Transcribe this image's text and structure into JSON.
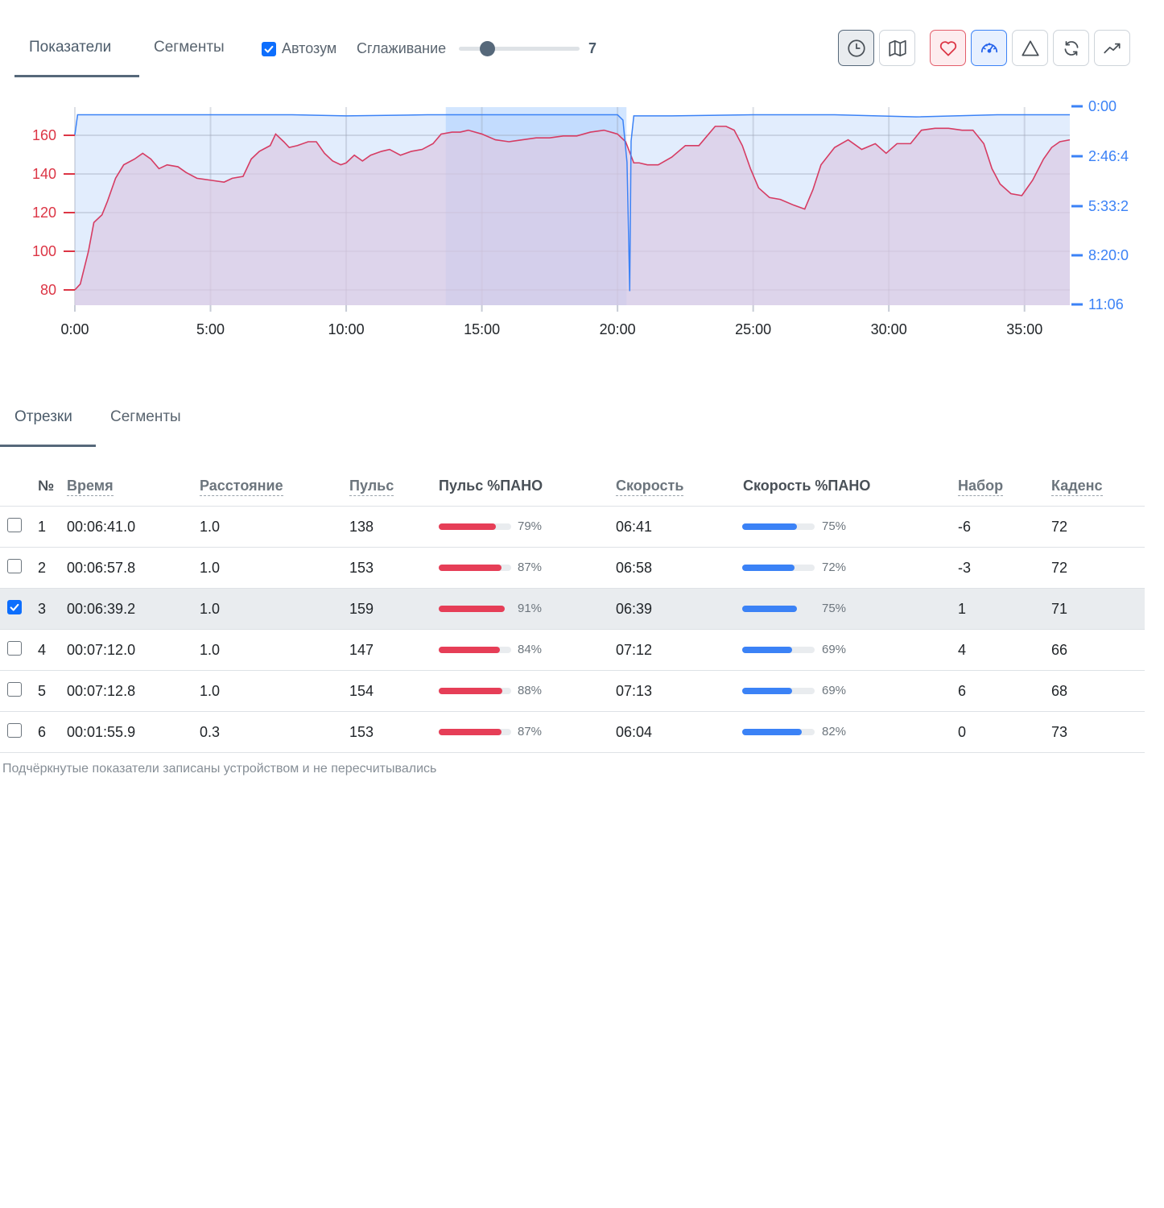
{
  "toolbar": {
    "tabs": [
      "Показатели",
      "Сегменты"
    ],
    "autozoom_label": "Автозум",
    "autozoom_checked": true,
    "smoothing_label": "Сглаживание",
    "smoothing_value": "7",
    "buttons": [
      "clock-icon",
      "map-icon",
      "heart-icon",
      "speedometer-icon",
      "triangle-icon",
      "refresh-icon",
      "trend-icon"
    ]
  },
  "chart_data": {
    "type": "area",
    "x_ticks": [
      "0:00",
      "5:00",
      "10:00",
      "15:00",
      "20:00",
      "25:00",
      "30:00",
      "35:00"
    ],
    "y_left_ticks": [
      "80",
      "100",
      "120",
      "140",
      "160"
    ],
    "y_right_ticks": [
      "0:00",
      "2:46:4",
      "5:33:2",
      "8:20:0",
      "11:06"
    ],
    "x_unit": "minutes",
    "xlim": [
      0,
      36.67
    ],
    "ylim_left": [
      72,
      175
    ],
    "colors": {
      "heart_rate": "#d63c63",
      "pace": "#3b82f6"
    },
    "selection_min": [
      13.67,
      20.33
    ],
    "series": [
      {
        "metric": "heart_rate",
        "points": [
          [
            0,
            80
          ],
          [
            0.2,
            83
          ],
          [
            0.5,
            100
          ],
          [
            0.7,
            115
          ],
          [
            1,
            119
          ],
          [
            1.2,
            126
          ],
          [
            1.5,
            138
          ],
          [
            1.8,
            145
          ],
          [
            2.2,
            148
          ],
          [
            2.5,
            151
          ],
          [
            2.8,
            148
          ],
          [
            3.1,
            143
          ],
          [
            3.4,
            145
          ],
          [
            3.8,
            144
          ],
          [
            4.1,
            141
          ],
          [
            4.5,
            138
          ],
          [
            5,
            137
          ],
          [
            5.5,
            136
          ],
          [
            5.8,
            138
          ],
          [
            6.2,
            139
          ],
          [
            6.5,
            148
          ],
          [
            6.8,
            152
          ],
          [
            7.2,
            155
          ],
          [
            7.4,
            161
          ],
          [
            7.7,
            157
          ],
          [
            7.9,
            154
          ],
          [
            8.2,
            155
          ],
          [
            8.6,
            157
          ],
          [
            8.9,
            157
          ],
          [
            9.2,
            151
          ],
          [
            9.5,
            147
          ],
          [
            9.8,
            145
          ],
          [
            10,
            146
          ],
          [
            10.3,
            150
          ],
          [
            10.6,
            147
          ],
          [
            10.9,
            150
          ],
          [
            11.3,
            152
          ],
          [
            11.6,
            153
          ],
          [
            12,
            150
          ],
          [
            12.4,
            152
          ],
          [
            12.8,
            153
          ],
          [
            13.2,
            156
          ],
          [
            13.5,
            161
          ],
          [
            13.9,
            162
          ],
          [
            14.2,
            162
          ],
          [
            14.5,
            163
          ],
          [
            15,
            161
          ],
          [
            15.5,
            158
          ],
          [
            16,
            157
          ],
          [
            16.5,
            158
          ],
          [
            17,
            159
          ],
          [
            17.5,
            159
          ],
          [
            18,
            160
          ],
          [
            18.5,
            160
          ],
          [
            19,
            162
          ],
          [
            19.5,
            163
          ],
          [
            20,
            161
          ],
          [
            20.3,
            157
          ],
          [
            20.6,
            146
          ],
          [
            20.8,
            146
          ],
          [
            21.1,
            145
          ],
          [
            21.5,
            145
          ],
          [
            22,
            149
          ],
          [
            22.5,
            155
          ],
          [
            23,
            155
          ],
          [
            23.3,
            160
          ],
          [
            23.6,
            165
          ],
          [
            24,
            165
          ],
          [
            24.3,
            163
          ],
          [
            24.6,
            155
          ],
          [
            24.9,
            143
          ],
          [
            25.2,
            133
          ],
          [
            25.6,
            128
          ],
          [
            26,
            127
          ],
          [
            26.5,
            124
          ],
          [
            26.9,
            122
          ],
          [
            27.2,
            132
          ],
          [
            27.5,
            145
          ],
          [
            28,
            154
          ],
          [
            28.5,
            158
          ],
          [
            29,
            153
          ],
          [
            29.5,
            156
          ],
          [
            29.9,
            151
          ],
          [
            30.3,
            156
          ],
          [
            30.8,
            156
          ],
          [
            31.2,
            163
          ],
          [
            31.7,
            164
          ],
          [
            32.2,
            164
          ],
          [
            32.7,
            163
          ],
          [
            33.1,
            163
          ],
          [
            33.5,
            156
          ],
          [
            33.8,
            143
          ],
          [
            34.1,
            135
          ],
          [
            34.5,
            130
          ],
          [
            34.9,
            129
          ],
          [
            35.3,
            137
          ],
          [
            35.7,
            148
          ],
          [
            36,
            154
          ],
          [
            36.3,
            157
          ],
          [
            36.67,
            158
          ]
        ]
      },
      {
        "metric": "pace",
        "points": [
          [
            0,
            1.2
          ],
          [
            0.1,
            0.25
          ],
          [
            2,
            0.25
          ],
          [
            5,
            0.25
          ],
          [
            8,
            0.25
          ],
          [
            10,
            0.3
          ],
          [
            13,
            0.25
          ],
          [
            16,
            0.25
          ],
          [
            20,
            0.25
          ],
          [
            20.2,
            0.5
          ],
          [
            20.35,
            2.5
          ],
          [
            20.45,
            8.6
          ],
          [
            20.5,
            1.5
          ],
          [
            20.6,
            0.3
          ],
          [
            22,
            0.3
          ],
          [
            25,
            0.25
          ],
          [
            28,
            0.25
          ],
          [
            31,
            0.35
          ],
          [
            34,
            0.25
          ],
          [
            36.67,
            0.25
          ]
        ]
      }
    ]
  },
  "segments_tabs": [
    "Отрезки",
    "Сегменты"
  ],
  "table": {
    "headers": {
      "num": "№",
      "time": "Время",
      "distance": "Расстояние",
      "hr": "Пульс",
      "hr_pano": "Пульс %ПАНО",
      "speed": "Скорость",
      "speed_pano": "Скорость %ПАНО",
      "elev": "Набор",
      "cadence": "Каденс"
    },
    "rows": [
      {
        "selected": false,
        "num": "1",
        "time": "00:06:41.0",
        "distance": "1.0",
        "hr": "138",
        "hr_pct": "79%",
        "hr_fill": 0.79,
        "speed": "06:41",
        "speed_pct": "75%",
        "speed_fill": 0.75,
        "elev": "-6",
        "cadence": "72"
      },
      {
        "selected": false,
        "num": "2",
        "time": "00:06:57.8",
        "distance": "1.0",
        "hr": "153",
        "hr_pct": "87%",
        "hr_fill": 0.87,
        "speed": "06:58",
        "speed_pct": "72%",
        "speed_fill": 0.72,
        "elev": "-3",
        "cadence": "72"
      },
      {
        "selected": true,
        "num": "3",
        "time": "00:06:39.2",
        "distance": "1.0",
        "hr": "159",
        "hr_pct": "91%",
        "hr_fill": 0.91,
        "speed": "06:39",
        "speed_pct": "75%",
        "speed_fill": 0.75,
        "elev": "1",
        "cadence": "71"
      },
      {
        "selected": false,
        "num": "4",
        "time": "00:07:12.0",
        "distance": "1.0",
        "hr": "147",
        "hr_pct": "84%",
        "hr_fill": 0.84,
        "speed": "07:12",
        "speed_pct": "69%",
        "speed_fill": 0.69,
        "elev": "4",
        "cadence": "66"
      },
      {
        "selected": false,
        "num": "5",
        "time": "00:07:12.8",
        "distance": "1.0",
        "hr": "154",
        "hr_pct": "88%",
        "hr_fill": 0.88,
        "speed": "07:13",
        "speed_pct": "69%",
        "speed_fill": 0.69,
        "elev": "6",
        "cadence": "68"
      },
      {
        "selected": false,
        "num": "6",
        "time": "00:01:55.9",
        "distance": "0.3",
        "hr": "153",
        "hr_pct": "87%",
        "hr_fill": 0.87,
        "speed": "06:04",
        "speed_pct": "82%",
        "speed_fill": 0.82,
        "elev": "0",
        "cadence": "73"
      }
    ]
  },
  "footnote": "Подчёркнутые показатели записаны устройством и не пересчитывались"
}
